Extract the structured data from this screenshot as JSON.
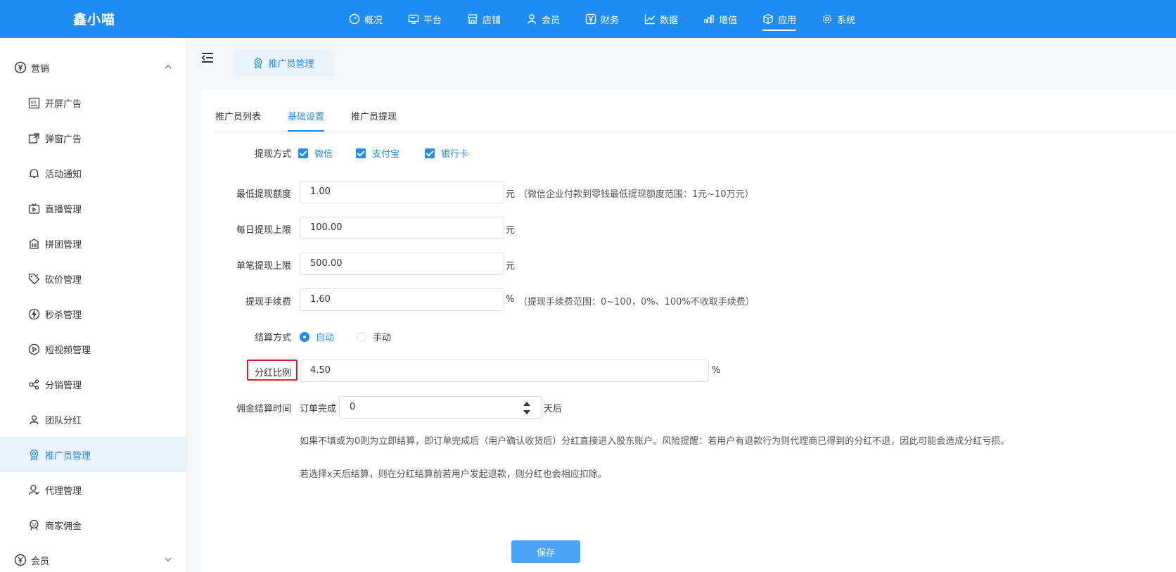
{
  "app": {
    "brand": "鑫小喵"
  },
  "topnav": {
    "items": [
      {
        "label": "概况",
        "icon": "dashboard-icon"
      },
      {
        "label": "平台",
        "icon": "monitor-icon"
      },
      {
        "label": "店铺",
        "icon": "store-icon"
      },
      {
        "label": "会员",
        "icon": "user-icon"
      },
      {
        "label": "财务",
        "icon": "yen-icon"
      },
      {
        "label": "数据",
        "icon": "line-chart-icon"
      },
      {
        "label": "增值",
        "icon": "bar-chart-icon"
      },
      {
        "label": "应用",
        "icon": "cube-icon",
        "active": true
      },
      {
        "label": "系统",
        "icon": "gear-icon"
      }
    ]
  },
  "sidebar": {
    "group_marketing": "营销",
    "items": [
      {
        "label": "开屏广告",
        "icon": "ad-icon"
      },
      {
        "label": "弹窗广告",
        "icon": "popup-icon"
      },
      {
        "label": "活动通知",
        "icon": "bell-icon"
      },
      {
        "label": "直播管理",
        "icon": "live-tv-icon"
      },
      {
        "label": "拼团管理",
        "icon": "group-buy-icon"
      },
      {
        "label": "砍价管理",
        "icon": "price-tag-icon"
      },
      {
        "label": "秒杀管理",
        "icon": "lightning-icon"
      },
      {
        "label": "短视频管理",
        "icon": "play-icon"
      },
      {
        "label": "分销管理",
        "icon": "share-icon"
      },
      {
        "label": "团队分红",
        "icon": "team-icon"
      },
      {
        "label": "推广员管理",
        "icon": "promoter-icon",
        "active": true
      },
      {
        "label": "代理管理",
        "icon": "agent-icon"
      },
      {
        "label": "商家佣金",
        "icon": "merchant-icon"
      }
    ],
    "group_member": "会员"
  },
  "page_tab": {
    "label": "推广员管理"
  },
  "tabs": [
    {
      "label": "推广员列表"
    },
    {
      "label": "基础设置",
      "active": true
    },
    {
      "label": "推广员提现"
    }
  ],
  "form": {
    "withdraw_method": {
      "label": "提现方式",
      "options": [
        {
          "label": "微信",
          "checked": true
        },
        {
          "label": "支付宝",
          "checked": true
        },
        {
          "label": "银行卡",
          "checked": true
        }
      ]
    },
    "min_withdraw": {
      "label": "最低提现额度",
      "value": "1.00",
      "unit": "元",
      "hint": "（微信企业付款到零钱最低提现额度范围：1元~10万元）"
    },
    "daily_limit": {
      "label": "每日提现上限",
      "value": "100.00",
      "unit": "元"
    },
    "single_limit": {
      "label": "单笔提现上限",
      "value": "500.00",
      "unit": "元"
    },
    "fee": {
      "label": "提现手续费",
      "value": "1.60",
      "unit": "%",
      "hint": "（提现手续费范围：0~100，0%、100%不收取手续费）"
    },
    "settle_method": {
      "label": "结算方式",
      "options": [
        {
          "label": "自动",
          "selected": true
        },
        {
          "label": "手动",
          "selected": false
        }
      ]
    },
    "dividend_ratio": {
      "label": "分红比例",
      "value": "4.50",
      "unit": "%"
    },
    "commission_time": {
      "label": "佣金结算时间",
      "prefix": "订单完成",
      "value": "0",
      "suffix": "天后",
      "note1": "如果不填或为0则为立即结算，即订单完成后（用户确认收货后）分红直接进入股东账户。风险提醒：若用户有退款行为则代理商已得到的分红不退，因此可能会造成分红亏损。",
      "note2": "若选择x天后结算，则在分红结算前若用户发起退款，则分红也会相应扣除。"
    },
    "save_label": "保存"
  },
  "colors": {
    "primary": "#1e8cf3",
    "highlight": "#e02020",
    "active_bg": "#e8f3fe"
  }
}
